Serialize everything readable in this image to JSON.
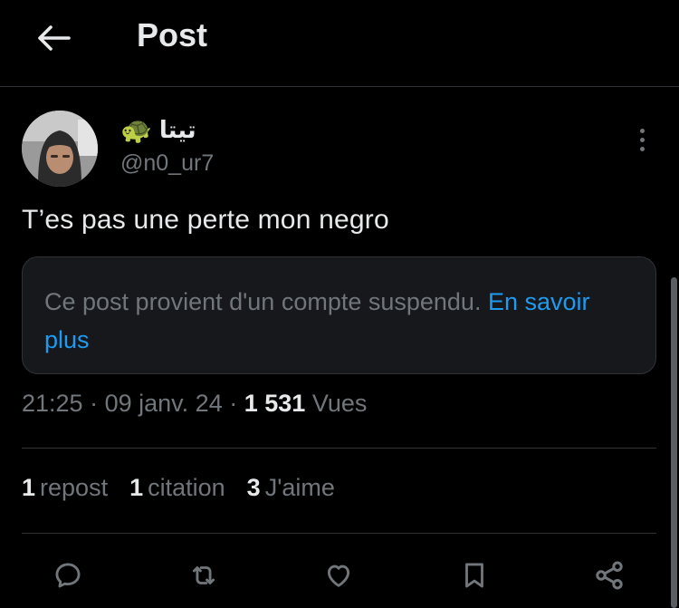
{
  "header": {
    "title": "Post",
    "back_icon": "arrow-left-icon"
  },
  "author": {
    "display_name": "تيتا",
    "emoji": "🐢",
    "handle": "@n0_ur7",
    "avatar": "profile-photo"
  },
  "post": {
    "text": "T’es pas une perte mon negro",
    "notice": {
      "text": "Ce post provient d'un compte suspendu.",
      "link_text": "En savoir plus"
    }
  },
  "meta": {
    "time": "21:25",
    "date": "09 janv. 24",
    "views_count": "1 531",
    "views_label": "Vues",
    "separator": "·"
  },
  "stats": [
    {
      "count": "1",
      "label": "repost"
    },
    {
      "count": "1",
      "label": "citation"
    },
    {
      "count": "3",
      "label": "J'aime"
    }
  ],
  "actions": [
    {
      "name": "reply-icon"
    },
    {
      "name": "repost-icon"
    },
    {
      "name": "like-icon"
    },
    {
      "name": "bookmark-icon"
    },
    {
      "name": "share-icon"
    }
  ],
  "colors": {
    "background": "#000000",
    "text_primary": "#e7e9ea",
    "text_secondary": "#71767b",
    "link": "#1d9bf0",
    "border": "#2f3336",
    "card": "#16181c"
  }
}
